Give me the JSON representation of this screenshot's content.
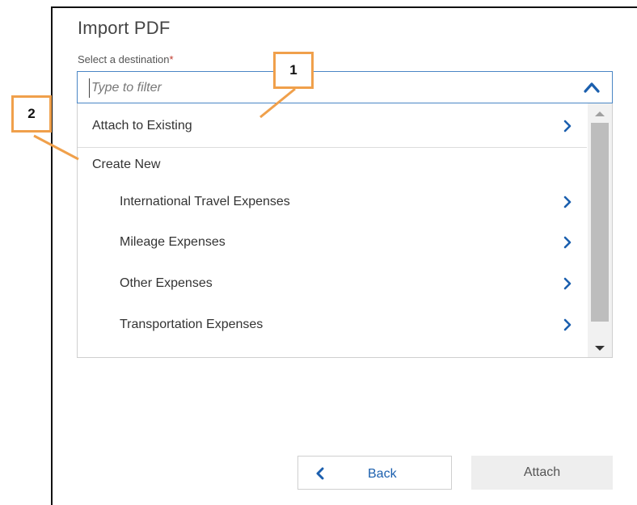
{
  "dialog": {
    "title": "Import PDF",
    "destination_label": "Select a destination",
    "required_marker": "*",
    "filter_placeholder": "Type to filter"
  },
  "dropdown": {
    "attach_existing": "Attach to Existing",
    "create_new": "Create New",
    "options": [
      "International Travel Expenses",
      "Mileage Expenses",
      "Other Expenses",
      "Transportation Expenses"
    ]
  },
  "buttons": {
    "back": "Back",
    "attach": "Attach"
  },
  "callouts": {
    "one": "1",
    "two": "2"
  },
  "colors": {
    "accent": "#1b5fae",
    "callout_border": "#f0a04b",
    "required": "#c0392b"
  },
  "icons": {
    "expand": "chevron-up-icon",
    "submenu": "chevron-right-icon",
    "back": "chevron-left-icon"
  }
}
